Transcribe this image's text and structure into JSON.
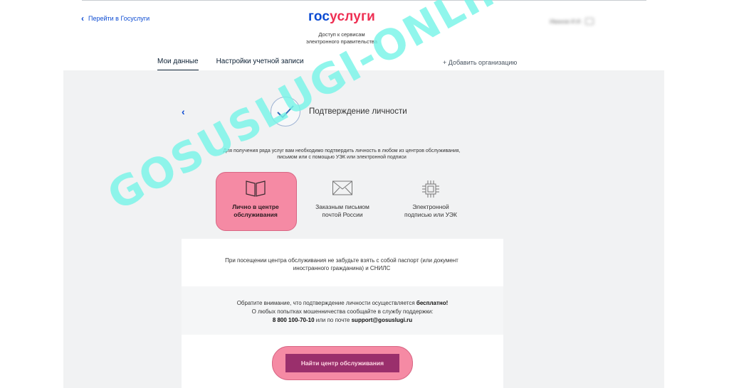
{
  "header": {
    "back_link": "Перейти в Госуслуги",
    "logo_part1": "гос",
    "logo_part2": "услуги",
    "subtitle_line1": "Доступ к сервисам",
    "subtitle_line2": "электронного правительства",
    "user_name": "Иванов И.И."
  },
  "tabs": [
    {
      "label": "Мои данные",
      "active": true
    },
    {
      "label": "Настройки учетной записи",
      "active": false
    }
  ],
  "add_org": "+ Добавить организацию",
  "page": {
    "title": "Подтверждение личности",
    "intro_line1": "Для получения ряда услуг вам необходимо подтвердить личность в любом из центров обслуживания,",
    "intro_line2": "письмом или с помощью УЭК или электронной подписи"
  },
  "methods": [
    {
      "icon": "book-icon",
      "line1": "Лично в центре",
      "line2": "обслуживания",
      "selected": true
    },
    {
      "icon": "envelope-icon",
      "line1": "Заказным письмом",
      "line2": "почтой России",
      "selected": false
    },
    {
      "icon": "chip-icon",
      "line1": "Электронной",
      "line2": "подписью или УЭК",
      "selected": false
    }
  ],
  "info": {
    "passport_line1": "При посещении центра обслуживания не забудьте взять с собой паспорт (или документ",
    "passport_line2": "иностранного гражданина) и СНИЛС",
    "notice_prefix": "Обратите внимание, что подтверждение личности осуществляется ",
    "notice_bold": "бесплатно!",
    "fraud_line": "О любых попытках мошенничества сообщайте в службу поддержки:",
    "phone": "8 800 100-70-10",
    "or_email": " или по почте ",
    "email": "support@gosuslugi.ru"
  },
  "find_button": "Найти центр обслуживания",
  "watermark": "GOSUSLUGI-ONLINE.RU",
  "colors": {
    "accent_blue": "#0d4cd3",
    "accent_red": "#ee2f53",
    "highlight_pink": "#f58aa4",
    "button_purple": "#9a2f6c",
    "watermark": "#78f4e8"
  }
}
